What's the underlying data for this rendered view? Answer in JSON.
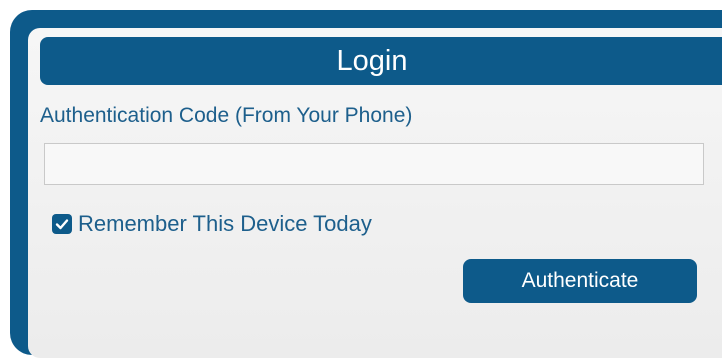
{
  "login": {
    "title": "Login",
    "code_label": "Authentication Code (From Your Phone)",
    "code_value": "",
    "remember_label": "Remember This Device Today",
    "remember_checked": true,
    "submit_label": "Authenticate"
  },
  "colors": {
    "accent": "#0d5a8a",
    "label_text": "#1d5f8c",
    "panel_bg": "#f2f2f2",
    "input_border": "#c9c9c9"
  },
  "icons": {
    "checkbox": "checkmark-icon"
  }
}
